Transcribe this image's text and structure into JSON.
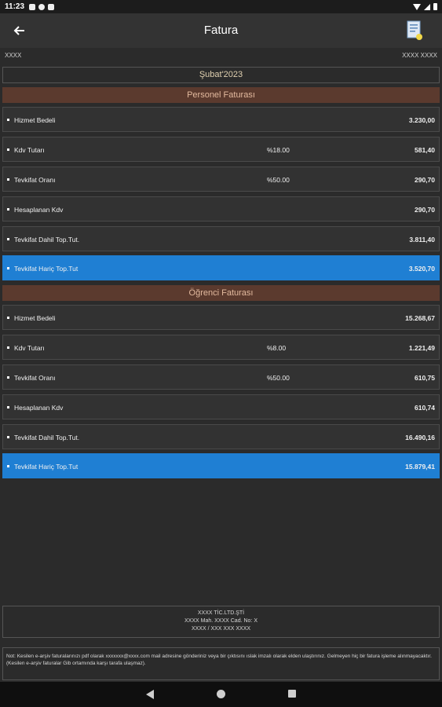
{
  "status_bar": {
    "time": "11:23"
  },
  "app_bar": {
    "title": "Fatura"
  },
  "header": {
    "left": "XXXX",
    "right": "XXXX XXXX"
  },
  "period": "Şubat'2023",
  "personel": {
    "title": "Personel Faturası",
    "rows": [
      {
        "label": "Hizmet Bedeli",
        "rate": "",
        "amount": "3.230,00"
      },
      {
        "label": "Kdv Tutarı",
        "rate": "%18.00",
        "amount": "581,40"
      },
      {
        "label": "Tevkifat Oranı",
        "rate": "%50.00",
        "amount": "290,70"
      },
      {
        "label": "Hesaplanan Kdv",
        "rate": "",
        "amount": "290,70"
      },
      {
        "label": "Tevkifat Dahil Top.Tut.",
        "rate": "",
        "amount": "3.811,40"
      },
      {
        "label": "Tevkifat Hariç Top.Tut",
        "rate": "",
        "amount": "3.520,70"
      }
    ]
  },
  "ogrenci": {
    "title": "Öğrenci Faturası",
    "rows": [
      {
        "label": "Hizmet Bedeli",
        "rate": "",
        "amount": "15.268,67"
      },
      {
        "label": "Kdv Tutarı",
        "rate": "%8.00",
        "amount": "1.221,49"
      },
      {
        "label": "Tevkifat Oranı",
        "rate": "%50.00",
        "amount": "610,75"
      },
      {
        "label": "Hesaplanan Kdv",
        "rate": "",
        "amount": "610,74"
      },
      {
        "label": "Tevkifat Dahil Top.Tut.",
        "rate": "",
        "amount": "16.490,16"
      },
      {
        "label": "Tevkifat Hariç Top.Tut",
        "rate": "",
        "amount": "15.879,41"
      }
    ]
  },
  "company": {
    "line1": "XXXX TİC.LTD.ŞTİ",
    "line2": "XXXX Mah. XXXX Cad. No: X",
    "line3": "XXXX / XXX XXX XXXX"
  },
  "note": "Not: Kesilen e-arşiv faturalarınızı pdf olarak xxxxxxx@xxxx.com mail adresine gönderiniz veya bir çıktısını ıslak imzalı olarak elden ulaştırınız. Gelmeyen hiç bir fatura işleme alınmayacaktır. (Kesilen e-arşiv faturalar Gib ortamında karşı tarafa ulaşmaz).",
  "icons": {
    "back": "arrow-left-icon",
    "document": "document-icon"
  },
  "colors": {
    "background": "#2b2b2b",
    "app_bar": "#333333",
    "section_header": "#5b3a2e",
    "highlight": "#1f7fd3"
  }
}
